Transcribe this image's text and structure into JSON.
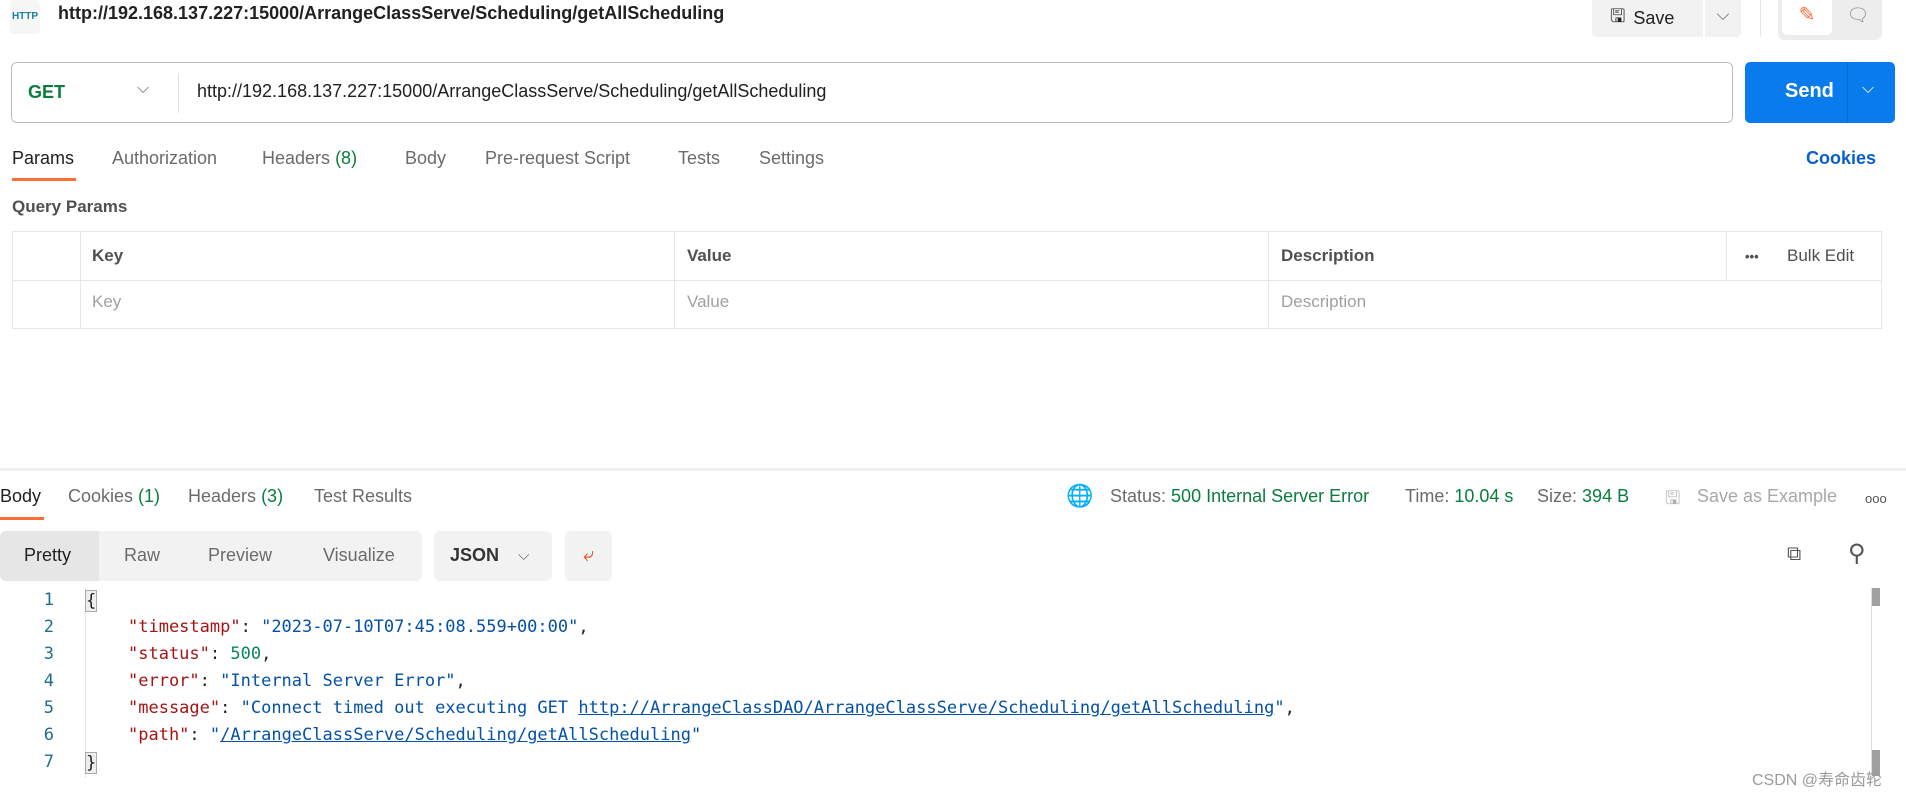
{
  "header": {
    "title": "http://192.168.137.227:15000/ArrangeClassServe/Scheduling/getAllScheduling",
    "icon": "http-icon",
    "icon_text": "HTTP",
    "save_label": "Save"
  },
  "request": {
    "method": "GET",
    "url": "http://192.168.137.227:15000/ArrangeClassServe/Scheduling/getAllScheduling",
    "send_label": "Send"
  },
  "tabs": [
    {
      "label": "Params"
    },
    {
      "label": "Authorization"
    },
    {
      "label": "Headers",
      "count": "(8)"
    },
    {
      "label": "Body"
    },
    {
      "label": "Pre-request Script"
    },
    {
      "label": "Tests"
    },
    {
      "label": "Settings"
    }
  ],
  "cookies_link": "Cookies",
  "query_params": {
    "title": "Query Params",
    "columns": [
      "Key",
      "Value",
      "Description"
    ],
    "bulk_edit": "Bulk Edit",
    "more": "•••",
    "placeholders": [
      "Key",
      "Value",
      "Description"
    ]
  },
  "response": {
    "tabs": [
      {
        "label": "Body"
      },
      {
        "label": "Cookies",
        "count": "(1)"
      },
      {
        "label": "Headers",
        "count": "(3)"
      },
      {
        "label": "Test Results"
      }
    ],
    "status_label": "Status:",
    "status": "500 Internal Server Error",
    "time_label": "Time:",
    "time": "10.04 s",
    "size_label": "Size:",
    "size": "394 B",
    "save_example": "Save as Example",
    "more": "ooo",
    "views": [
      "Pretty",
      "Raw",
      "Preview",
      "Visualize"
    ],
    "format": "JSON",
    "accent": "#ff6c37",
    "status_color": "#0a7d3e",
    "body": {
      "lines": [
        "1",
        "2",
        "3",
        "4",
        "5",
        "6",
        "7"
      ],
      "open": "{",
      "close": "}",
      "timestamp_key": "\"timestamp\"",
      "timestamp_val": "\"2023-07-10T07:45:08.559+00:00\"",
      "status_key": "\"status\"",
      "status_val": "500",
      "error_key": "\"error\"",
      "error_val": "\"Internal Server Error\"",
      "message_key": "\"message\"",
      "message_prefix": "\"Connect timed out executing GET ",
      "message_url": "http://ArrangeClassDAO/ArrangeClassServe/Scheduling/getAllScheduling",
      "path_key": "\"path\"",
      "path_val": "/ArrangeClassServe/Scheduling/getAllScheduling"
    }
  },
  "watermark": "CSDN @寿命齿轮"
}
